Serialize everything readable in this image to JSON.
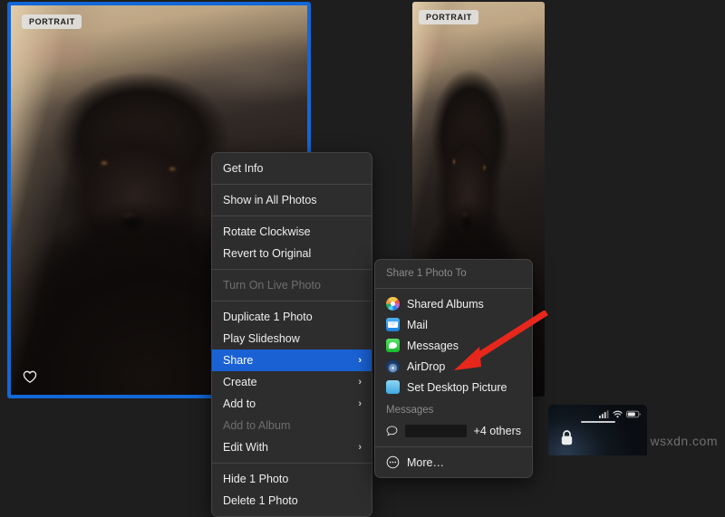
{
  "app": {
    "name": "Photos",
    "background_color": "#1e1e1e"
  },
  "photos": [
    {
      "name": "primary-photo",
      "badge": "PORTRAIT",
      "selected": true,
      "selection_color": "#1268d8",
      "favorite_icon": "heart-icon",
      "subject": "black labrador dog"
    },
    {
      "name": "secondary-photo",
      "badge": "PORTRAIT",
      "selected": false,
      "subject": "black labrador dog"
    }
  ],
  "context_menu": {
    "name": "photo-context-menu",
    "groups": [
      {
        "items": [
          {
            "label": "Get Info",
            "state": "enabled",
            "submenu": false
          }
        ]
      },
      {
        "items": [
          {
            "label": "Show in All Photos",
            "state": "enabled",
            "submenu": false
          }
        ]
      },
      {
        "items": [
          {
            "label": "Rotate Clockwise",
            "state": "enabled",
            "submenu": false
          },
          {
            "label": "Revert to Original",
            "state": "enabled",
            "submenu": false
          }
        ]
      },
      {
        "items": [
          {
            "label": "Turn On Live Photo",
            "state": "disabled",
            "submenu": false
          }
        ]
      },
      {
        "items": [
          {
            "label": "Duplicate 1 Photo",
            "state": "enabled",
            "submenu": false
          },
          {
            "label": "Play Slideshow",
            "state": "enabled",
            "submenu": false
          },
          {
            "label": "Share",
            "state": "highlighted",
            "submenu": true,
            "chevron": "›"
          },
          {
            "label": "Create",
            "state": "enabled",
            "submenu": true,
            "chevron": "›"
          },
          {
            "label": "Add to",
            "state": "enabled",
            "submenu": true,
            "chevron": "›"
          },
          {
            "label": "Add to Album",
            "state": "disabled",
            "submenu": false
          },
          {
            "label": "Edit With",
            "state": "enabled",
            "submenu": true,
            "chevron": "›"
          }
        ]
      },
      {
        "items": [
          {
            "label": "Hide 1 Photo",
            "state": "enabled",
            "submenu": false
          },
          {
            "label": "Delete 1 Photo",
            "state": "enabled",
            "submenu": false
          }
        ]
      }
    ],
    "highlight_color": "#1a62d4"
  },
  "share_submenu": {
    "name": "share-submenu",
    "header": "Share 1 Photo To",
    "items": [
      {
        "label": "Shared Albums",
        "icon": "photos-app-icon"
      },
      {
        "label": "Mail",
        "icon": "mail-app-icon"
      },
      {
        "label": "Messages",
        "icon": "messages-app-icon"
      },
      {
        "label": "AirDrop",
        "icon": "airdrop-icon"
      },
      {
        "label": "Set Desktop Picture",
        "icon": "desktop-picture-icon"
      }
    ],
    "suggestions": {
      "header": "Messages",
      "contact_redacted": true,
      "others_label": "+4 others",
      "chat_icon": "speech-bubble-icon"
    },
    "more": {
      "label": "More…",
      "icon": "ellipsis-circle-icon"
    }
  },
  "annotation": {
    "name": "pointer-arrow",
    "color": "#e8271c",
    "points_to": "Set Desktop Picture",
    "direction": "up-right-to-down-left"
  },
  "phone_preview": {
    "name": "iphone-lockscreen-preview",
    "lock_icon": "lock-icon",
    "status_icons": [
      "cellular-signal-icon",
      "wifi-icon",
      "battery-icon"
    ],
    "home_indicator": true
  },
  "watermark": {
    "text": "wsxdn.com"
  }
}
